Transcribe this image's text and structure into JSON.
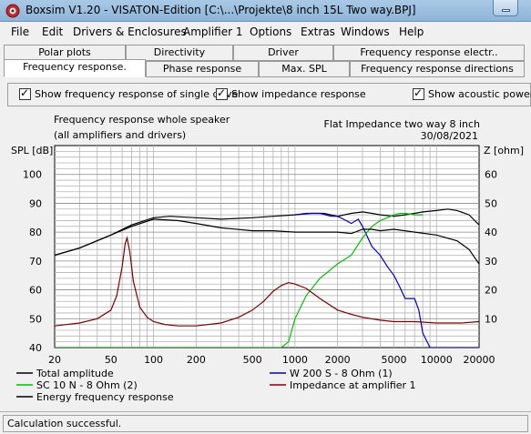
{
  "window": {
    "title": "Boxsim V1.20 - VISATON-Edition [C:\\...\\Projekte\\8 inch 15L Two way.BPJ]"
  },
  "menu": [
    "File",
    "Edit",
    "Drivers & Enclosures",
    "Amplifier 1",
    "Options",
    "Extras",
    "Windows",
    "Help"
  ],
  "tabs_row1": [
    "Polar plots",
    "Directivity",
    "Driver",
    "Frequency response electr.."
  ],
  "tabs_row2": [
    "Frequency response.",
    "Phase response",
    "Max. SPL",
    "Frequency response directions"
  ],
  "active_tab": "Frequency response.",
  "options": {
    "single_drive": {
      "label": "Show frequency response of single drive",
      "checked": true
    },
    "impedance": {
      "label": "Show impedance response",
      "checked": true
    },
    "acoustic_power": {
      "label": "Show acoustic power",
      "checked": true
    }
  },
  "chart": {
    "heading_left_1": "Frequency response whole speaker",
    "heading_left_2": "(all amplifiers and drivers)",
    "heading_right_1": "Flat Impedance two way 8 inch",
    "heading_right_2": "30/08/2021"
  },
  "legend": [
    {
      "key": "total",
      "label": "Total amplitude",
      "color": "#000000"
    },
    {
      "key": "w200",
      "label": "W 200 S - 8 Ohm (1)",
      "color": "#0000c0"
    },
    {
      "key": "sc10",
      "label": "SC 10 N - 8 Ohm (2)",
      "color": "#00c000"
    },
    {
      "key": "imp",
      "label": "Impedance at amplifier 1",
      "color": "#800000"
    },
    {
      "key": "energy",
      "label": "Energy frequency response",
      "color": "#000000"
    }
  ],
  "status": "Calculation successful.",
  "colors": {
    "grid": "#b4b4b4",
    "plot_bg": "#ffffff"
  },
  "chart_data": {
    "type": "line",
    "title": "Frequency response whole speaker",
    "xlabel": "",
    "ylabel": "SPL [dB]",
    "y2label": "Z [ohm]",
    "x_scale": "log",
    "xlim": [
      20,
      20000
    ],
    "ylim": [
      40,
      110
    ],
    "y2lim": [
      0,
      70
    ],
    "x_ticks": [
      20,
      50,
      100,
      200,
      500,
      1000,
      2000,
      5000,
      10000,
      20000
    ],
    "x_tick_labels": [
      "20",
      "50",
      "100",
      "200",
      "500",
      "1000",
      "2000",
      "5000",
      "10000",
      "20000"
    ],
    "y_ticks": [
      40,
      50,
      60,
      70,
      80,
      90,
      100
    ],
    "y_tick_labels": [
      "40",
      "50",
      "60",
      "70",
      "80",
      "90",
      "100"
    ],
    "y2_ticks": [
      10,
      20,
      30,
      40,
      50,
      60
    ],
    "y2_tick_labels": [
      "10",
      "20",
      "30",
      "40",
      "50",
      "60"
    ],
    "grid": true,
    "legend_position": "bottom",
    "series": [
      {
        "name": "Total amplitude",
        "axis": "left",
        "color": "#000000",
        "x": [
          20,
          30,
          50,
          70,
          100,
          130,
          200,
          300,
          500,
          700,
          1000,
          1300,
          1600,
          2000,
          2500,
          3000,
          3500,
          4000,
          5000,
          6000,
          7000,
          8000,
          10000,
          12000,
          14000,
          17000,
          20000
        ],
        "y": [
          72,
          74.5,
          79,
          82.5,
          85,
          85.5,
          85,
          84.5,
          85,
          85.5,
          86,
          86.5,
          86.5,
          85.5,
          86.5,
          87,
          86.5,
          86,
          85.5,
          86,
          86.5,
          87,
          87.5,
          88,
          87.5,
          86,
          82.5
        ]
      },
      {
        "name": "W 200 S - 8 Ohm (1)",
        "axis": "left",
        "color": "#0000c0",
        "x": [
          1000,
          1200,
          1500,
          1800,
          2000,
          2300,
          2500,
          2800,
          3000,
          3500,
          4000,
          4500,
          5000,
          5500,
          6000,
          6500,
          7000,
          7500,
          8000,
          9000,
          10000,
          20000
        ],
        "y": [
          86,
          86.5,
          86.5,
          85.5,
          85.5,
          84,
          83,
          84.5,
          82,
          75,
          72,
          68,
          65,
          61,
          57,
          57,
          57,
          53,
          45,
          40,
          40,
          40
        ]
      },
      {
        "name": "SC 10 N - 8 Ohm (2)",
        "axis": "left",
        "color": "#00c000",
        "x": [
          20,
          500,
          700,
          800,
          900,
          1000,
          1200,
          1500,
          2000,
          2500,
          3000,
          3500,
          4000,
          4500,
          5000,
          5500,
          6000,
          7000,
          8000
        ],
        "y": [
          40,
          40,
          40,
          40,
          42,
          50,
          58,
          64,
          69,
          72,
          78,
          82,
          84,
          85,
          86,
          86.5,
          86.5,
          86,
          86
        ]
      },
      {
        "name": "Impedance at amplifier 1",
        "axis": "right",
        "color": "#800000",
        "x": [
          20,
          30,
          40,
          50,
          55,
          60,
          63,
          65,
          68,
          72,
          80,
          90,
          100,
          120,
          150,
          200,
          300,
          400,
          500,
          600,
          700,
          800,
          900,
          1000,
          1200,
          1500,
          2000,
          2500,
          3000,
          4000,
          5000,
          7000,
          10000,
          15000,
          20000
        ],
        "y": [
          7.5,
          8.5,
          10,
          13,
          18,
          28,
          36,
          38,
          33,
          23,
          14,
          10.5,
          9,
          8,
          7.5,
          7.5,
          8.5,
          10.5,
          13,
          16,
          19.5,
          21.5,
          22.5,
          22,
          20.5,
          17,
          13,
          11.5,
          10.5,
          9.5,
          9,
          9,
          8.5,
          8.5,
          9
        ]
      },
      {
        "name": "Energy frequency response",
        "axis": "left",
        "color": "#000000",
        "x": [
          20,
          30,
          50,
          70,
          100,
          150,
          200,
          300,
          500,
          700,
          1000,
          1500,
          2000,
          2500,
          3000,
          3500,
          4000,
          5000,
          7000,
          10000,
          14000,
          17000,
          20000
        ],
        "y": [
          72,
          74.5,
          79,
          82,
          84.5,
          84,
          83,
          81.5,
          80.5,
          80.5,
          80,
          80,
          80,
          79.5,
          81,
          81,
          80.5,
          81,
          80,
          79,
          77,
          74,
          69
        ]
      }
    ]
  }
}
